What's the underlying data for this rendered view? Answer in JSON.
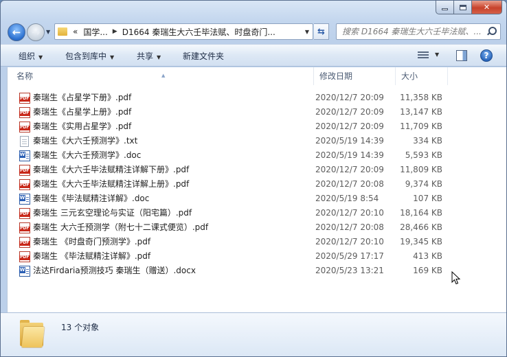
{
  "address_bar": {
    "overflow": "«",
    "crumbs": [
      "国学...",
      "D1664 秦瑞生大六壬毕法赋、时盘奇门..."
    ]
  },
  "search": {
    "placeholder": "搜索 D1664 秦瑞生大六壬毕法赋、..."
  },
  "toolbar": {
    "organize": "组织",
    "include_in_library": "包含到库中",
    "share": "共享",
    "new_folder": "新建文件夹"
  },
  "columns": {
    "name": "名称",
    "date_modified": "修改日期",
    "size": "大小"
  },
  "files": [
    {
      "icon": "pdf-icon",
      "name": "秦瑞生《占星学下册》.pdf",
      "date": "2020/12/7 20:09",
      "size": "11,358 KB"
    },
    {
      "icon": "pdf-icon",
      "name": "秦瑞生《占星学上册》.pdf",
      "date": "2020/12/7 20:09",
      "size": "13,147 KB"
    },
    {
      "icon": "pdf-icon",
      "name": "秦瑞生《实用占星学》.pdf",
      "date": "2020/12/7 20:09",
      "size": "11,709 KB"
    },
    {
      "icon": "txt-icon",
      "name": "秦瑞生《大六壬预测学》.txt",
      "date": "2020/5/19 14:39",
      "size": "334 KB"
    },
    {
      "icon": "doc-icon",
      "name": "秦瑞生《大六壬预测学》.doc",
      "date": "2020/5/19 14:39",
      "size": "5,593 KB"
    },
    {
      "icon": "pdf-icon",
      "name": "秦瑞生《大六壬毕法赋精注详解下册》.pdf",
      "date": "2020/12/7 20:09",
      "size": "11,809 KB"
    },
    {
      "icon": "pdf-icon",
      "name": "秦瑞生《大六壬毕法赋精注详解上册》.pdf",
      "date": "2020/12/7 20:08",
      "size": "9,374 KB"
    },
    {
      "icon": "doc-icon",
      "name": "秦瑞生《毕法赋精注详解》.doc",
      "date": "2020/5/19 8:54",
      "size": "107 KB"
    },
    {
      "icon": "pdf-icon",
      "name": "秦瑞生 三元玄空理论与实证（阳宅篇）.pdf",
      "date": "2020/12/7 20:10",
      "size": "18,164 KB"
    },
    {
      "icon": "pdf-icon",
      "name": "秦瑞生 大六壬预测学（附七十二课式便览）.pdf",
      "date": "2020/12/7 20:08",
      "size": "28,466 KB"
    },
    {
      "icon": "pdf-icon",
      "name": "秦瑞生 《时盘奇门预测学》.pdf",
      "date": "2020/12/7 20:10",
      "size": "19,345 KB"
    },
    {
      "icon": "pdf-icon",
      "name": "秦瑞生 《毕法赋精注详解》.pdf",
      "date": "2020/5/29 17:17",
      "size": "413 KB"
    },
    {
      "icon": "doc-icon",
      "name": "法达Firdaria预测技巧 秦瑞生（赠送）.docx",
      "date": "2020/5/23 13:21",
      "size": "169 KB"
    }
  ],
  "status": {
    "count_text": "13 个对象"
  }
}
